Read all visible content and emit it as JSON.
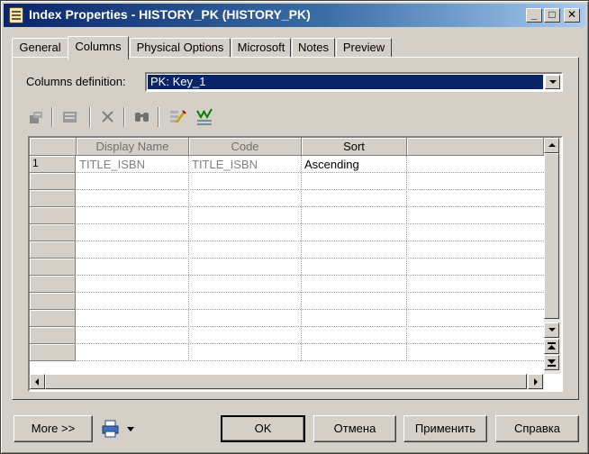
{
  "window": {
    "title": "Index Properties - HISTORY_PK (HISTORY_PK)"
  },
  "titlebar_buttons": {
    "minimize": "_",
    "maximize": "□",
    "close": "✕"
  },
  "tabs": [
    "General",
    "Columns",
    "Physical Options",
    "Microsoft",
    "Notes",
    "Preview"
  ],
  "active_tab": "Columns",
  "columns_definition": {
    "label": "Columns definition:",
    "value": "PK: Key_1"
  },
  "toolbar_icons": [
    "properties-icon",
    "add-columns-icon",
    "delete-icon",
    "find-icon",
    "customize-columns-icon",
    "filter-icon"
  ],
  "grid": {
    "headers": [
      "Display Name",
      "Code",
      "Sort"
    ],
    "rows": [
      {
        "num": "1",
        "display_name": "TITLE_ISBN",
        "code": "TITLE_ISBN",
        "sort": "Ascending"
      }
    ]
  },
  "buttons": {
    "more": "More >>",
    "ok": "OK",
    "cancel": "Отмена",
    "apply": "Применить",
    "help": "Справка"
  },
  "colors": {
    "title_active": "#0a246a",
    "face": "#d4d0c8",
    "selection": "#0a246a"
  }
}
